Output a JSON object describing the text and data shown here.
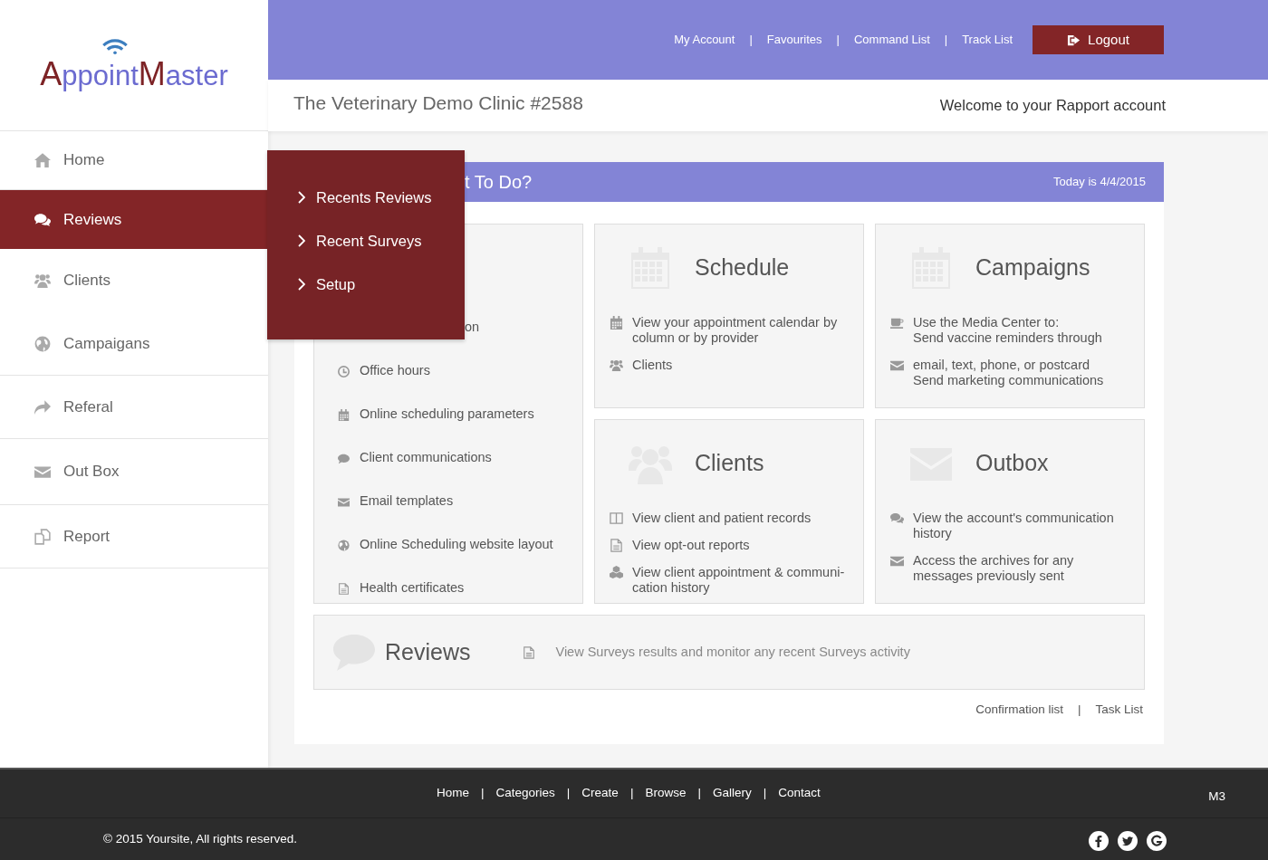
{
  "logo": {
    "segments": [
      {
        "text": "A",
        "kind": "accent"
      },
      {
        "text": "ppoint",
        "kind": "plain"
      },
      {
        "text": "M",
        "kind": "accent"
      },
      {
        "text": "aster",
        "kind": "plain"
      }
    ]
  },
  "sidebar": {
    "items": [
      {
        "label": "Home",
        "selected": false
      },
      {
        "label": "Reviews",
        "selected": true
      },
      {
        "label": "Clients",
        "selected": false
      },
      {
        "label": "Campaigans",
        "selected": false
      },
      {
        "label": "Referal",
        "selected": false
      },
      {
        "label": "Out Box",
        "selected": false
      },
      {
        "label": "Report",
        "selected": false
      }
    ]
  },
  "top_nav": {
    "separator": "|",
    "links": [
      "My Account",
      "Favourites",
      "Command List",
      "Track List"
    ],
    "logout": "Logout"
  },
  "subheader": {
    "title": "The Veterinary Demo Clinic #2588",
    "welcome": "Welcome to your Rapport account"
  },
  "flyout": {
    "items": [
      "Recents Reviews",
      "Recent Surveys",
      "Setup"
    ]
  },
  "panel": {
    "heading": "t To Do?",
    "date": "Today is 4/4/2015"
  },
  "setup_card": {
    "items": [
      "on",
      "Office hours",
      "Online scheduling parameters",
      "Client communications",
      "Email templates",
      "Online Scheduling website layout",
      "Health certificates"
    ]
  },
  "cards": [
    {
      "title": "Schedule",
      "items": [
        "View your appointment calendar by column or by provider",
        "Clients"
      ]
    },
    {
      "title": "Campaigns",
      "items": [
        "Use the Media Center to:\nSend vaccine reminders through",
        "email, text, phone, or postcard\nSend marketing communications"
      ]
    },
    {
      "title": "Clients",
      "items": [
        "View client and patient records",
        "View opt-out reports",
        "View client appointment & communi-cation history"
      ]
    },
    {
      "title": "Outbox",
      "items": [
        "View the account's communication history",
        "Access the archives for any messages previously sent"
      ]
    }
  ],
  "reviews_card": {
    "title": "Reviews",
    "text": "View Surveys results and monitor any recent Surveys activity"
  },
  "bottom_links": {
    "separator": "|",
    "links": [
      "Confirmation list",
      "Task List"
    ]
  },
  "footer": {
    "separator": "|",
    "links": [
      "Home",
      "Categories",
      "Create",
      "Browse",
      "Gallery",
      "Contact"
    ],
    "badge": "M3",
    "copyright": "© 2015 Yoursite, All rights reserved."
  }
}
